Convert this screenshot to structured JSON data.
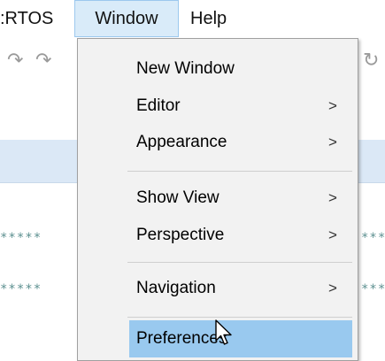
{
  "menubar": {
    "items": [
      {
        "label": ":RTOS"
      },
      {
        "label": "Window"
      },
      {
        "label": "Help"
      }
    ]
  },
  "background": {
    "star_text": "*****"
  },
  "window_menu": {
    "items": [
      {
        "label": "New Window",
        "has_submenu": false
      },
      {
        "label": "Editor",
        "has_submenu": true
      },
      {
        "label": "Appearance",
        "has_submenu": true
      },
      {
        "label": "Show View",
        "has_submenu": true
      },
      {
        "label": "Perspective",
        "has_submenu": true
      },
      {
        "label": "Navigation",
        "has_submenu": true
      },
      {
        "label": "Preferences",
        "has_submenu": false,
        "highlighted": true
      }
    ],
    "submenu_arrow": ">"
  },
  "colors": {
    "menu_open_bg": "#d9ebf9",
    "highlight_bg": "#99c9ef",
    "menu_bg": "#f2f2f2"
  }
}
